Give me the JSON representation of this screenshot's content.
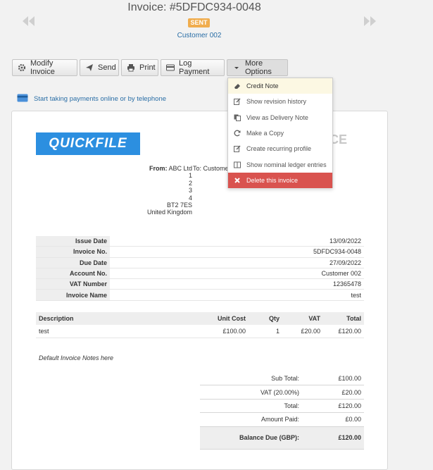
{
  "invoice": {
    "title": "Invoice: #5DFDC934-0048",
    "status": "SENT",
    "customer_link": "Customer 002"
  },
  "toolbar": {
    "modify": "Modify Invoice",
    "send": "Send",
    "print": "Print",
    "log_payment": "Log Payment",
    "more_options": "More Options"
  },
  "online_payments": "Start taking payments online or by telephone",
  "more_menu": [
    {
      "label": "Credit Note",
      "icon": "eraser-icon"
    },
    {
      "label": "Show revision history",
      "icon": "edit-icon"
    },
    {
      "label": "View as Delivery Note",
      "icon": "copy-doc-icon"
    },
    {
      "label": "Make a Copy",
      "icon": "refresh-icon"
    },
    {
      "label": "Create recurring profile",
      "icon": "edit-icon"
    },
    {
      "label": "Show nominal ledger entries",
      "icon": "book-icon"
    },
    {
      "label": "Delete this invoice",
      "icon": "times-icon"
    }
  ],
  "document": {
    "logo_text": "QUICKFILE",
    "heading_partial": "CE",
    "from_label": "From:",
    "from_name": "ABC Ltd",
    "to_partial": "To: Custome",
    "address": [
      "1",
      "2",
      "3",
      "4",
      "BT2 7ES",
      "United Kingdom"
    ],
    "meta": [
      {
        "label": "Issue Date",
        "value": "13/09/2022"
      },
      {
        "label": "Invoice No.",
        "value": "5DFDC934-0048"
      },
      {
        "label": "Due Date",
        "value": "27/09/2022"
      },
      {
        "label": "Account No.",
        "value": "Customer 002"
      },
      {
        "label": "VAT Number",
        "value": "12365478"
      },
      {
        "label": "Invoice Name",
        "value": "test"
      }
    ],
    "lines": {
      "headers": [
        "Description",
        "Unit Cost",
        "Qty",
        "VAT",
        "Total"
      ],
      "rows": [
        [
          "test",
          "£100.00",
          "1",
          "£20.00",
          "£120.00"
        ]
      ]
    },
    "notes": "Default Invoice Notes here",
    "totals": [
      {
        "label": "Sub Total:",
        "value": "£100.00"
      },
      {
        "label": "VAT (20.00%)",
        "value": "£20.00"
      },
      {
        "label": "Total:",
        "value": "£120.00"
      },
      {
        "label": "Amount Paid:",
        "value": "£0.00"
      }
    ],
    "balance": {
      "label": "Balance Due (GBP):",
      "value": "£120.00"
    }
  },
  "colors": {
    "accent": "#2a6ea6",
    "badge": "#f0ad4e",
    "danger": "#d9534f",
    "logo": "#2c8fe0",
    "highlight": "#fcf8e3"
  }
}
